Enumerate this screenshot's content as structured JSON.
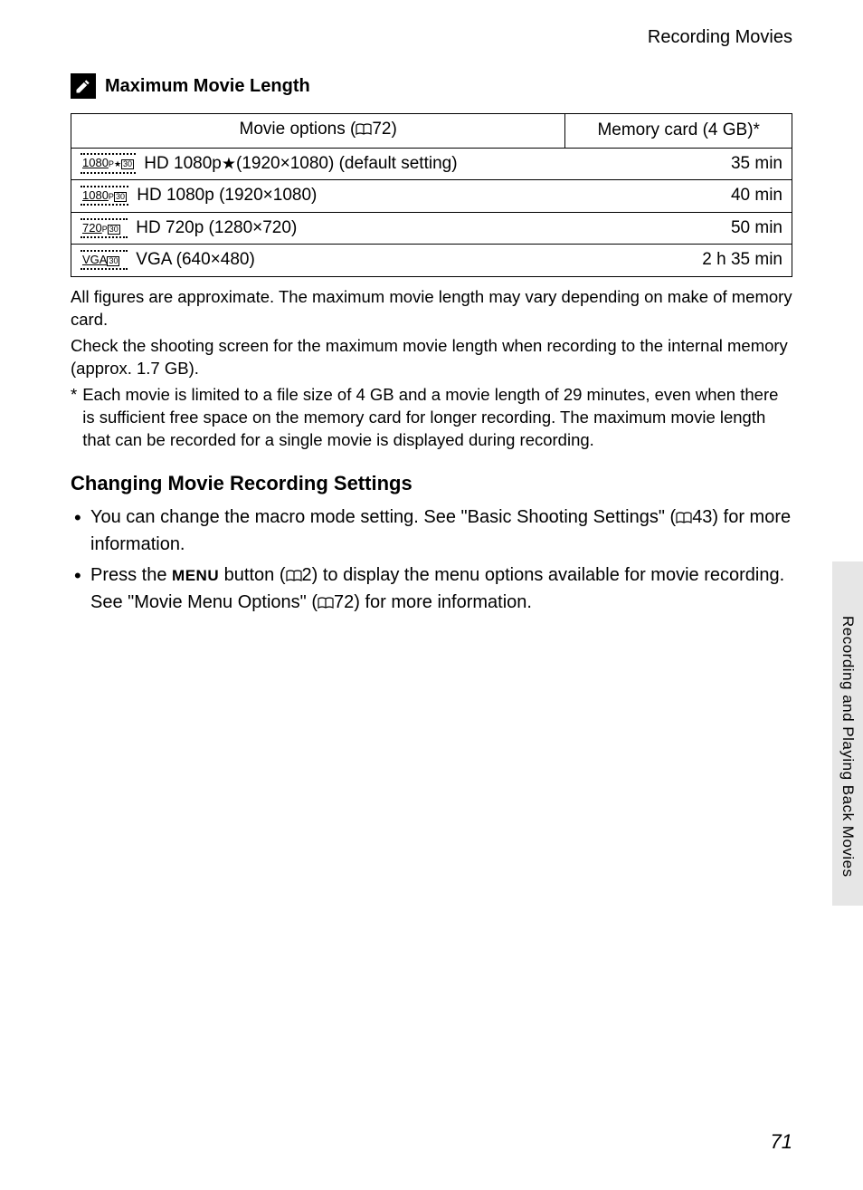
{
  "running_head": "Recording Movies",
  "section_title": "Maximum Movie Length",
  "table": {
    "head_options": "Movie options (",
    "head_options_ref": "72)",
    "head_card": "Memory card (4 GB)*",
    "rows": [
      {
        "icon_res": "1080",
        "icon_sub": "P",
        "icon_box": "30",
        "icon_star": true,
        "label": " HD 1080p",
        "star_after": true,
        "extra": "(1920×1080) (default setting)",
        "value": "35 min"
      },
      {
        "icon_res": "1080",
        "icon_sub": "P",
        "icon_box": "30",
        "icon_star": false,
        "label": " HD 1080p (1920×1080)",
        "star_after": false,
        "extra": "",
        "value": "40 min"
      },
      {
        "icon_res": "720",
        "icon_sub": "P",
        "icon_box": "30",
        "icon_star": false,
        "label": " HD 720p (1280×720)",
        "star_after": false,
        "extra": "",
        "value": "50 min"
      },
      {
        "icon_res": "VGA",
        "icon_sub": "",
        "icon_box": "30",
        "icon_star": false,
        "label": " VGA (640×480)",
        "star_after": false,
        "extra": "",
        "value": "2 h 35 min"
      }
    ]
  },
  "notes": {
    "p1": "All figures are approximate. The maximum movie length may vary depending on make of memory card.",
    "p2": "Check the shooting screen for the maximum movie length when recording to the internal memory (approx. 1.7 GB)."
  },
  "footnote_mark": "*",
  "footnote_text": "Each movie is limited to a file size of 4 GB and a movie length of 29 minutes, even when there is sufficient free space on the memory card for longer recording. The maximum movie length that can be recorded for a single movie is displayed during recording.",
  "subhead": "Changing Movie Recording Settings",
  "bullets": {
    "b1_a": "You can change the macro mode setting. See \"Basic Shooting Settings\" (",
    "b1_ref": "43) for more information.",
    "b2_a": "Press the ",
    "b2_menu": "MENU",
    "b2_b": " button (",
    "b2_ref1": "2) to display the menu options available for movie recording. See \"Movie Menu Options\" (",
    "b2_ref2": "72) for more information."
  },
  "side_tab": "Recording and Playing Back Movies",
  "page_number": "71"
}
